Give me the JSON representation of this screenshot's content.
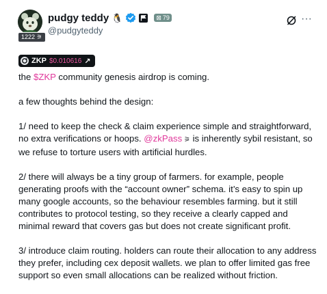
{
  "author": {
    "display_name": "pudgy teddy",
    "handle": "@pudgyteddy",
    "level_badge": "1222",
    "score_badge": "79",
    "verified_icon": "verified-badge-icon",
    "affiliate_icon": "flag-icon"
  },
  "actions": {
    "grok_icon": "grok-icon",
    "more_label": "···"
  },
  "ticker": {
    "symbol": "ZKP",
    "price": "$0.010616",
    "arrow": "↗",
    "price_color": "#f05aa4"
  },
  "post": {
    "p1_before": "the ",
    "p1_cashtag": "$ZKP",
    "p1_after": " community genesis airdrop is coming.",
    "p2": "a few thoughts behind the design:",
    "p3_before": "1/ need to keep the check & claim experience simple and straightforward, no extra verifications or hoops. ",
    "p3_mention": "@zkPass",
    "p3_after": " is inherently sybil resistant, so we refuse to torture users with artificial hurdles.",
    "p4": "2/ there will always be a tiny group of farmers. for example, people generating proofs with the “account owner” schema. it’s easy to spin up many google accounts, so the behaviour resembles farming. but it still contributes to protocol testing, so they receive a clearly capped and minimal reward that covers gas but does not create significant profit.",
    "p5": "3/ introduce claim routing. holders can route their allocation to any address they prefer, including cex deposit wallets. we plan to offer limited gas free support so even small allocations can be realized without friction."
  },
  "colors": {
    "link": "#e0389b",
    "text": "#0f1419",
    "secondary": "#536471"
  }
}
